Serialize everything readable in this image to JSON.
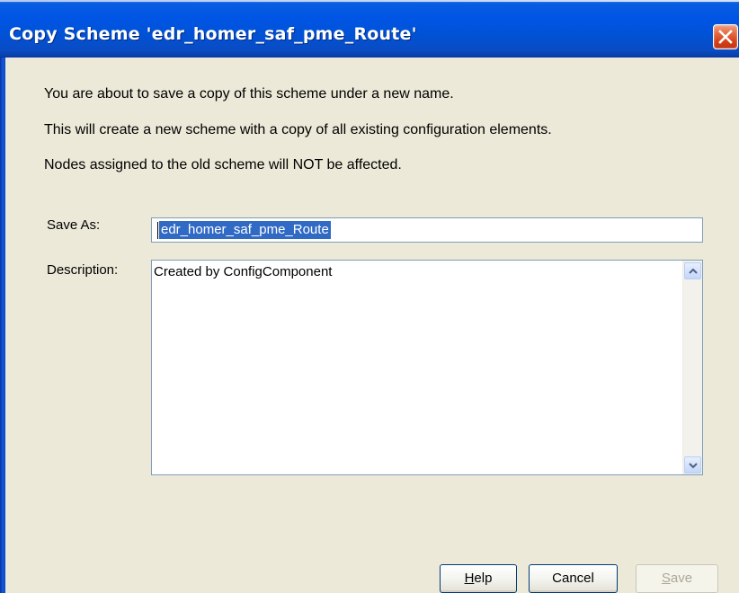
{
  "window": {
    "title": "Copy Scheme 'edr_homer_saf_pme_Route'"
  },
  "message": {
    "line1": "You are about to save a copy of this scheme under a new name.",
    "line2": "This will create a new scheme with a copy of all existing configuration elements.",
    "line3": "Nodes assigned to the old scheme will NOT be affected."
  },
  "form": {
    "save_as_label": "Save As:",
    "save_as_value": "edr_homer_saf_pme_Route",
    "description_label": "Description:",
    "description_value": "Created by ConfigComponent"
  },
  "buttons": {
    "help_first": "H",
    "help_rest": "elp",
    "cancel": "Cancel",
    "save_first": "S",
    "save_rest": "ave"
  },
  "icons": {
    "close": "close-icon",
    "scroll_up": "scroll-up-arrow-icon",
    "scroll_down": "scroll-down-arrow-icon"
  },
  "colors": {
    "titlebar": "#0055e5",
    "dialog_bg": "#ece9d8",
    "selection": "#316ac5",
    "close_button": "#d4401a"
  }
}
